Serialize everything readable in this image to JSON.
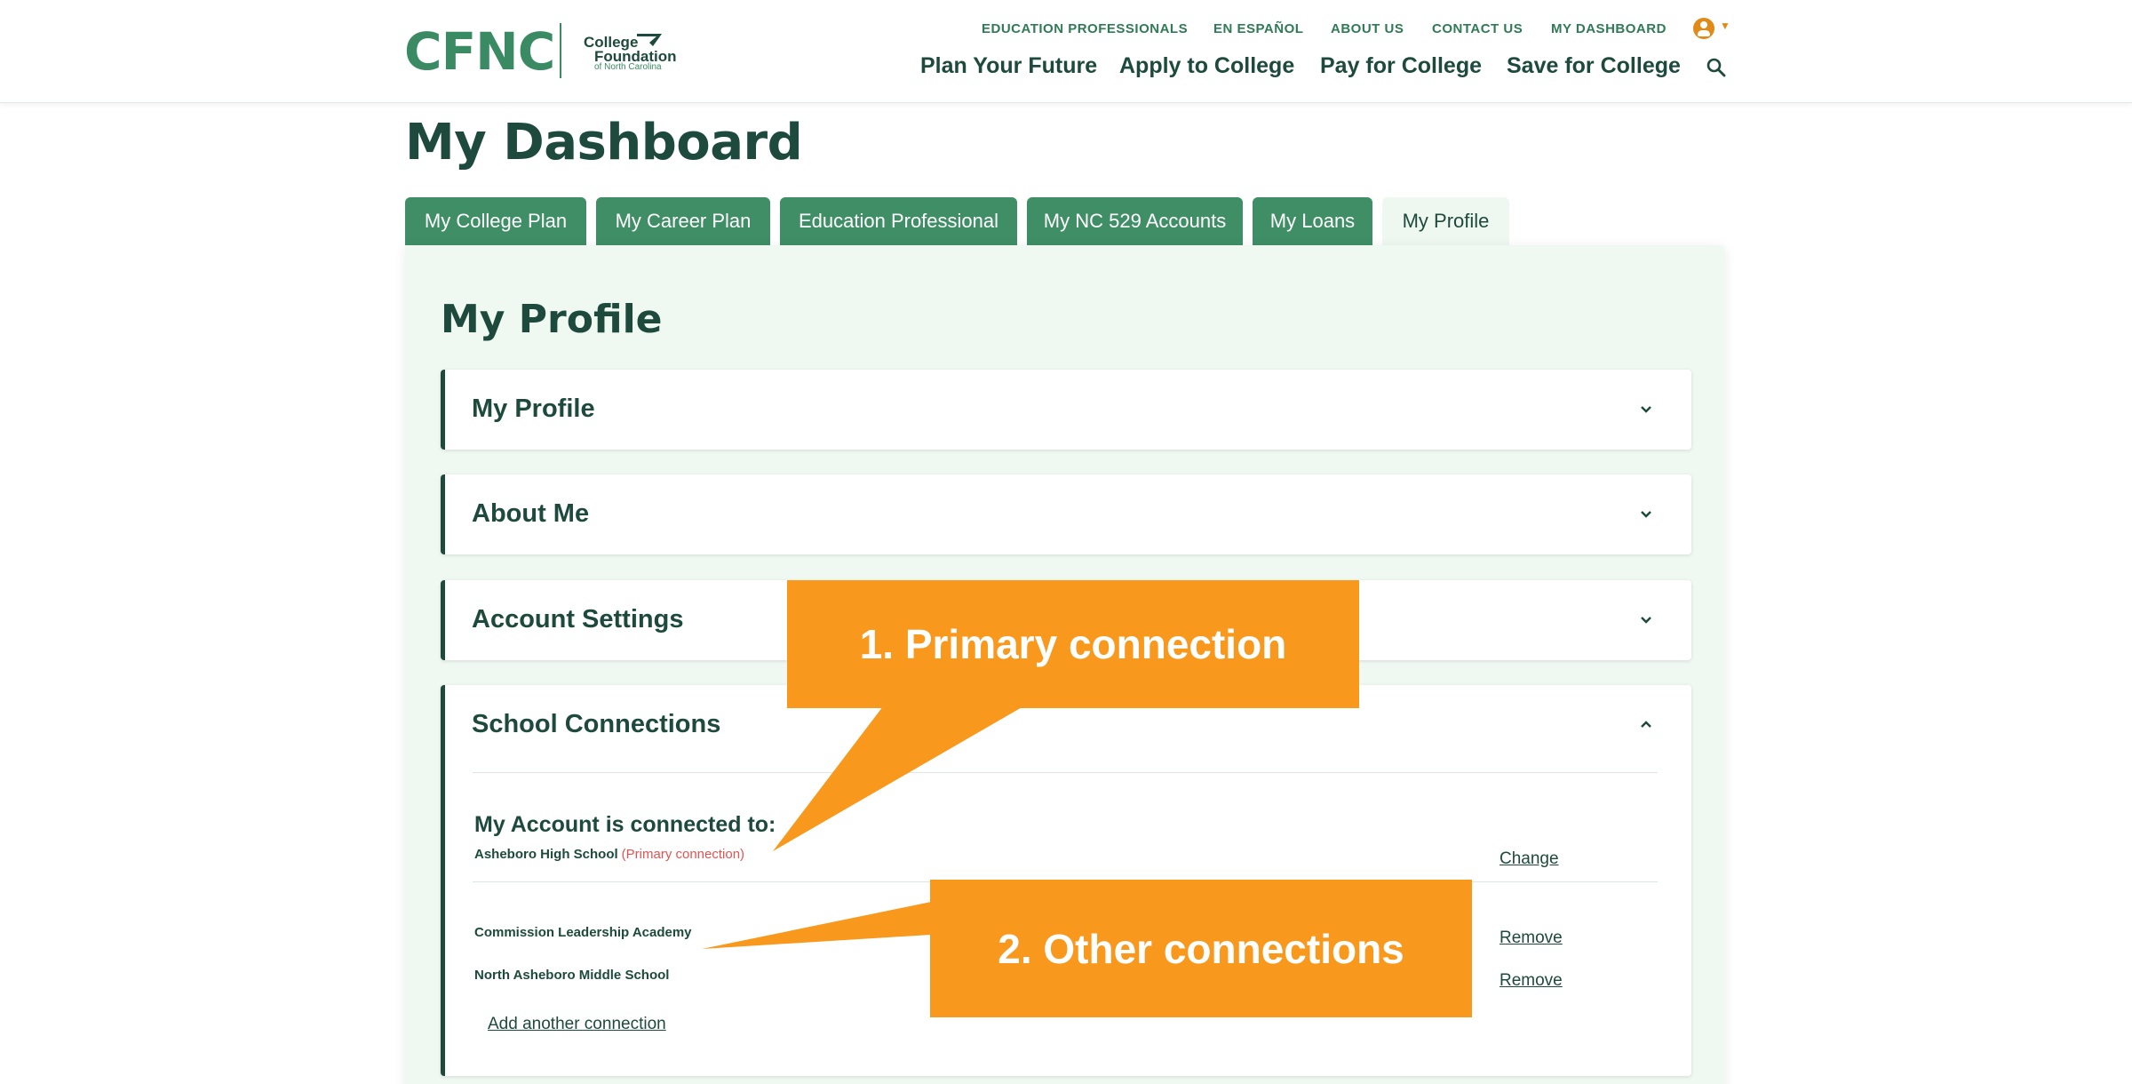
{
  "header": {
    "logo_text": "CFNC",
    "logo_sub_line1": "College",
    "logo_sub_line2": "Foundation",
    "logo_sub_line3": "of North Carolina",
    "util_nav": [
      "EDUCATION PROFESSIONALS",
      "EN ESPAÑOL",
      "ABOUT US",
      "CONTACT US",
      "MY DASHBOARD"
    ],
    "main_nav": [
      "Plan Your Future",
      "Apply to College",
      "Pay for College",
      "Save for College"
    ]
  },
  "page": {
    "title": "My Dashboard"
  },
  "tabs": [
    {
      "label": "My College Plan",
      "active": false
    },
    {
      "label": "My Career Plan",
      "active": false
    },
    {
      "label": "Education Professional",
      "active": false
    },
    {
      "label": "My NC 529 Accounts",
      "active": false
    },
    {
      "label": "My Loans",
      "active": false
    },
    {
      "label": "My Profile",
      "active": true
    }
  ],
  "panel": {
    "title": "My Profile",
    "sections": [
      {
        "label": "My Profile",
        "expanded": false
      },
      {
        "label": "About Me",
        "expanded": false
      },
      {
        "label": "Account Settings",
        "expanded": false
      },
      {
        "label": "School Connections",
        "expanded": true
      }
    ]
  },
  "connections": {
    "heading": "My Account is connected to:",
    "primary": {
      "name": "Asheboro High School",
      "tag": "(Primary connection)",
      "action": "Change"
    },
    "others": [
      {
        "name": "Commission Leadership Academy",
        "action": "Remove"
      },
      {
        "name": "North Asheboro Middle School",
        "action": "Remove"
      }
    ],
    "add_link": "Add another connection"
  },
  "callouts": [
    {
      "text": "1. Primary connection"
    },
    {
      "text": "2. Other connections"
    }
  ],
  "colors": {
    "brand_green": "#3a8a63",
    "dark_green": "#1d4a3c",
    "tab_green": "#3f8e66",
    "panel_bg": "#eff9f2",
    "callout_orange": "#f8991d",
    "primary_tag_red": "#e05454"
  }
}
